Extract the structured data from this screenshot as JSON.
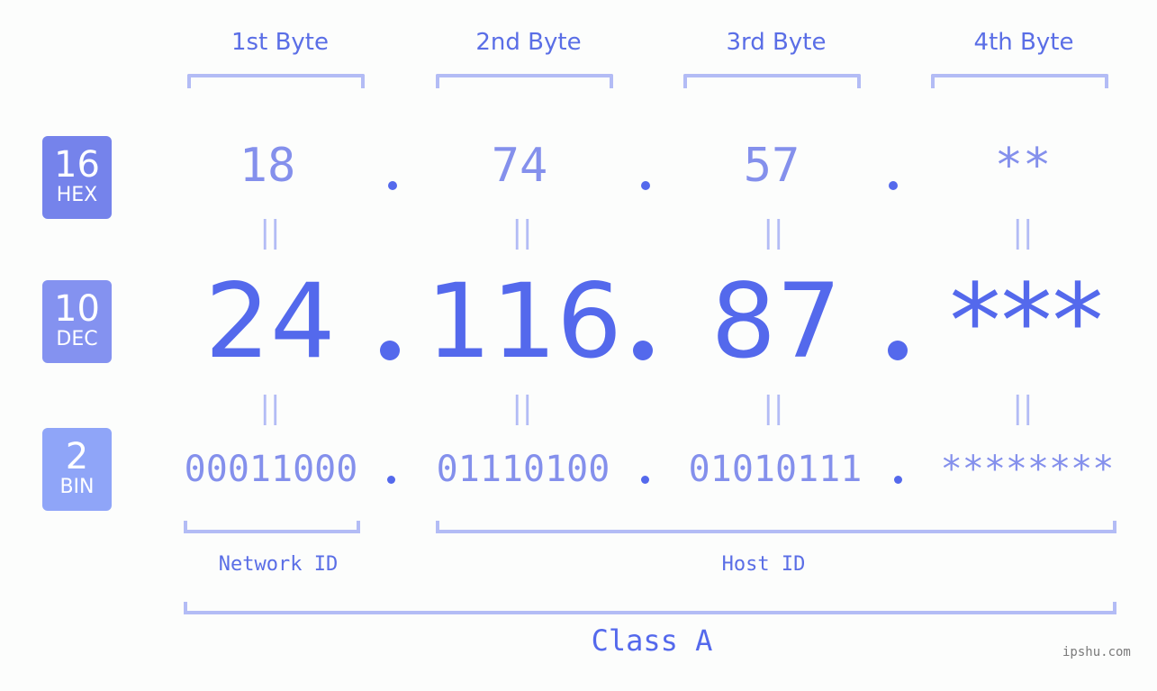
{
  "byte_headers": [
    "1st Byte",
    "2nd Byte",
    "3rd Byte",
    "4th Byte"
  ],
  "badges": [
    {
      "base": "16",
      "label": "HEX",
      "color": "#7583eb"
    },
    {
      "base": "10",
      "label": "DEC",
      "color": "#8492f0"
    },
    {
      "base": "2",
      "label": "BIN",
      "color": "#8fa5f8"
    }
  ],
  "hex": [
    "18",
    "74",
    "57",
    "**"
  ],
  "dec": [
    "24",
    "116",
    "87",
    "***"
  ],
  "bin": [
    "00011000",
    "01110100",
    "01010111",
    "********"
  ],
  "equals_symbol": "||",
  "separator": ".",
  "network_label": "Network ID",
  "host_label": "Host ID",
  "class_label": "Class A",
  "watermark": "ipshu.com",
  "colors": {
    "primary": "#5469ec",
    "secondary": "#8490ec",
    "bracket": "#b3bcf5",
    "background": "#fcfdfc"
  }
}
